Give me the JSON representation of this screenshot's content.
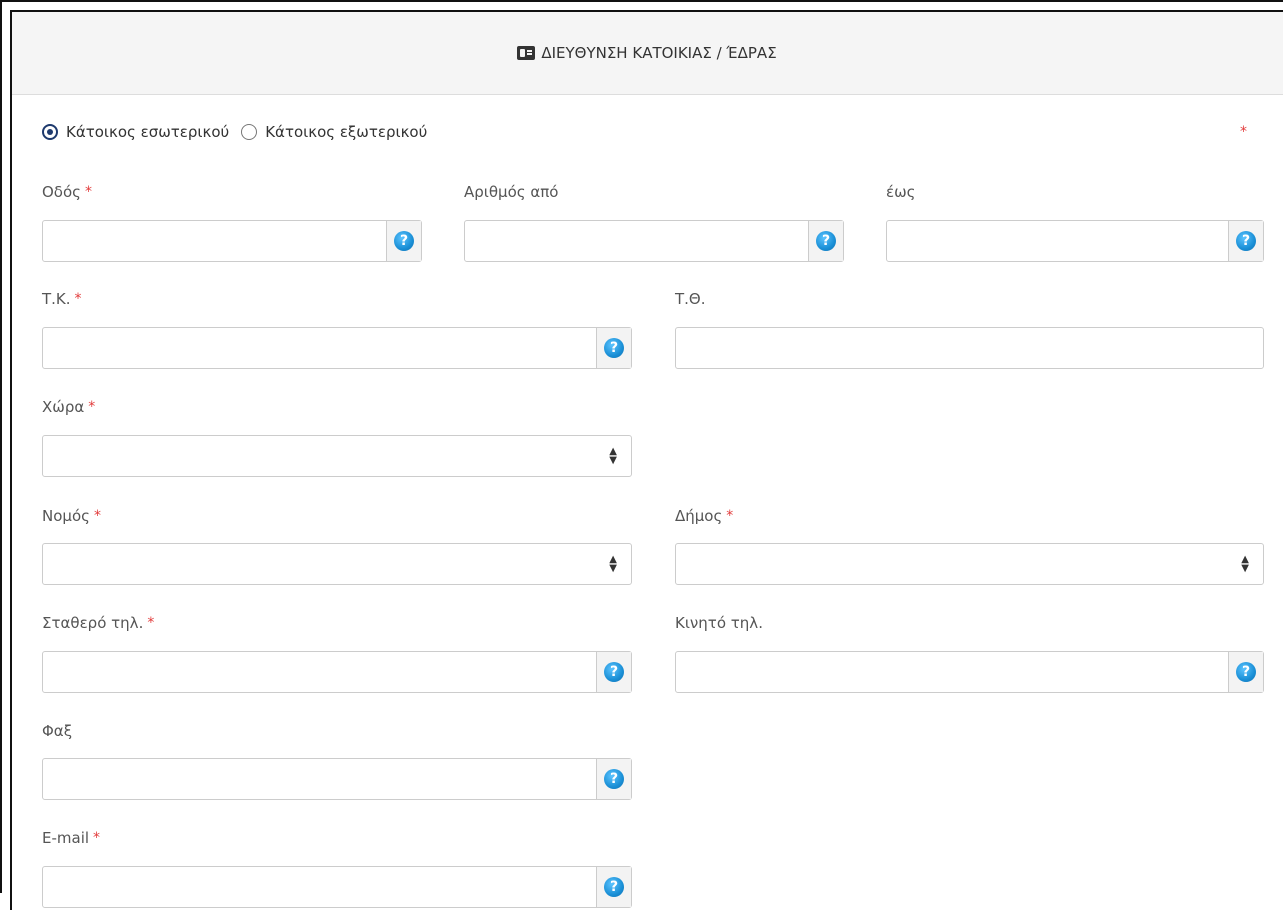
{
  "section": {
    "title": "ΔΙΕΥΘΥΝΣΗ ΚΑΤΟΙΚΙΑΣ / ΈΔΡΑΣ",
    "icon": "id-card-icon"
  },
  "residence": {
    "options": [
      {
        "label": "Κάτοικος εσωτερικού",
        "checked": true
      },
      {
        "label": "Κάτοικος εξωτερικού",
        "checked": false
      }
    ],
    "required_mark": "*"
  },
  "fields": {
    "street": {
      "label": "Οδός",
      "required": "*",
      "value": ""
    },
    "number_from": {
      "label": "Αριθμός από",
      "value": ""
    },
    "number_to": {
      "label": "έως",
      "value": ""
    },
    "postal_code": {
      "label": "Τ.Κ.",
      "required": "*",
      "value": ""
    },
    "po_box": {
      "label": "Τ.Θ.",
      "value": ""
    },
    "country": {
      "label": "Χώρα",
      "required": "*",
      "selected": ""
    },
    "prefecture": {
      "label": "Νομός",
      "required": "*",
      "selected": ""
    },
    "municipality": {
      "label": "Δήμος",
      "required": "*",
      "selected": ""
    },
    "landline": {
      "label": "Σταθερό τηλ.",
      "required": "*",
      "value": ""
    },
    "mobile": {
      "label": "Κινητό τηλ.",
      "value": ""
    },
    "fax": {
      "label": "Φαξ",
      "value": ""
    },
    "email": {
      "label": "E-mail",
      "required": "*",
      "value": ""
    }
  },
  "help_icon_glyph": "?",
  "select_arrow_glyph": "⬍",
  "colors": {
    "required": "#e23b3b",
    "help_icon": "#1a8fd6",
    "radio_checked": "#1e3a6e",
    "header_bg": "#f5f5f5"
  }
}
